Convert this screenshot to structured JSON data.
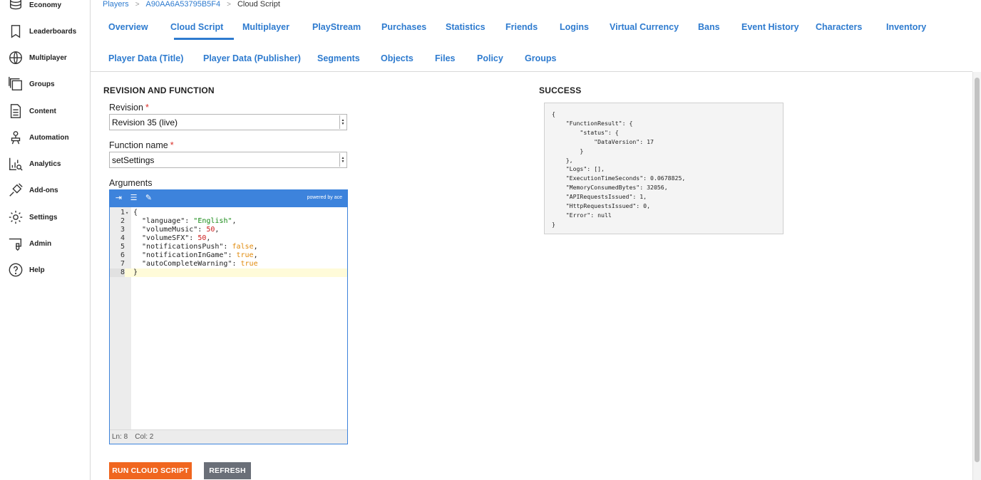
{
  "sidebar": {
    "items": [
      {
        "label": "Economy",
        "icon": "economy-icon"
      },
      {
        "label": "Leaderboards",
        "icon": "leaderboards-icon"
      },
      {
        "label": "Multiplayer",
        "icon": "multiplayer-icon"
      },
      {
        "label": "Groups",
        "icon": "groups-icon"
      },
      {
        "label": "Content",
        "icon": "content-icon"
      },
      {
        "label": "Automation",
        "icon": "automation-icon"
      },
      {
        "label": "Analytics",
        "icon": "analytics-icon"
      },
      {
        "label": "Add-ons",
        "icon": "add-ons-icon"
      },
      {
        "label": "Settings",
        "icon": "settings-icon"
      },
      {
        "label": "Admin",
        "icon": "admin-icon"
      },
      {
        "label": "Help",
        "icon": "help-icon"
      }
    ]
  },
  "breadcrumb": {
    "players": "Players",
    "player_id": "A90AA6A53795B5F4",
    "current": "Cloud Script"
  },
  "tabs": {
    "row1": [
      "Overview",
      "Cloud Script",
      "Multiplayer",
      "PlayStream",
      "Purchases",
      "Statistics",
      "Friends",
      "Logins",
      "Virtual Currency",
      "Bans",
      "Event History",
      "Characters",
      "Inventory"
    ],
    "row2": [
      "Player Data (Title)",
      "Player Data (Publisher)",
      "Segments",
      "Objects",
      "Files",
      "Policy",
      "Groups"
    ],
    "active": "Cloud Script"
  },
  "form": {
    "section_title": "REVISION AND FUNCTION",
    "revision_label": "Revision",
    "revision_value": "Revision 35 (live)",
    "function_label": "Function name",
    "function_value": "setSettings",
    "required_mark": "*",
    "arguments_label": "Arguments"
  },
  "editor": {
    "powered_by": "powered by ace",
    "lines": [
      "{",
      "  \"language\": \"English\",",
      "  \"volumeMusic\": 50,",
      "  \"volumeSFX\": 50,",
      "  \"notificationsPush\": false,",
      "  \"notificationInGame\": true,",
      "  \"autoCompleteWarning\": true",
      "}"
    ],
    "status_ln": "Ln: 8",
    "status_col": "Col: 2"
  },
  "result": {
    "title": "SUCCESS",
    "text": "{\n    \"FunctionResult\": {\n        \"status\": {\n            \"DataVersion\": 17\n        }\n    },\n    \"Logs\": [],\n    \"ExecutionTimeSeconds\": 0.0678825,\n    \"MemoryConsumedBytes\": 32056,\n    \"APIRequestsIssued\": 1,\n    \"HttpRequestsIssued\": 0,\n    \"Error\": null\n}"
  },
  "buttons": {
    "run": "RUN CLOUD SCRIPT",
    "refresh": "REFRESH"
  },
  "colors": {
    "link_blue": "#2e7bcf",
    "editor_blue": "#3d83dc",
    "run_orange": "#f0661f",
    "refresh_gray": "#6a6f78"
  }
}
